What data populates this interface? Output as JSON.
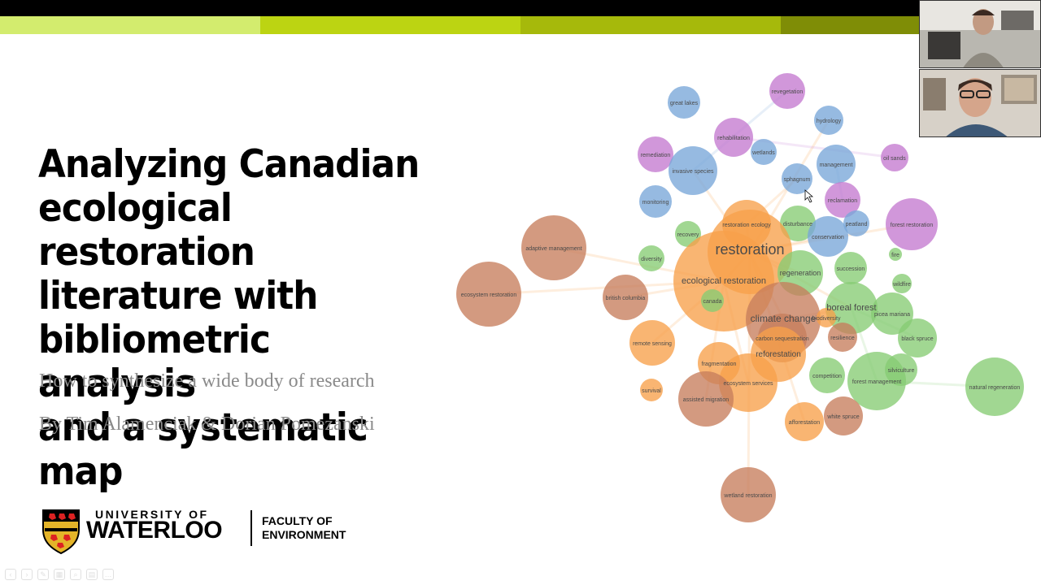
{
  "slide": {
    "title": "Analyzing Canadian\necological restoration\nliterature with\nbibliometric analysis\nand a systematic map",
    "subtitle": "How to synthesize a wide body of research",
    "authors": "By Tim Alamenciak & Dorian Pomezanski",
    "logo": {
      "university_line": "UNIVERSITY OF",
      "name": "WATERLOO",
      "faculty_line1": "FACULTY OF",
      "faculty_line2": "ENVIRONMENT"
    },
    "top_band_colors": [
      "#d3ec6e",
      "#bcd412",
      "#a6b90b",
      "#7f8d06"
    ]
  },
  "network": {
    "cluster_colors": {
      "blue": "#79a6d8",
      "purple": "#c47ad0",
      "orange": "#f7a04a",
      "green": "#86cc73",
      "brown": "#c67d5c"
    },
    "nodes": [
      {
        "label": "great lakes",
        "c": "blue"
      },
      {
        "label": "revegetation",
        "c": "purple"
      },
      {
        "label": "hydrology",
        "c": "blue"
      },
      {
        "label": "rehabilitation",
        "c": "purple"
      },
      {
        "label": "wetlands",
        "c": "blue"
      },
      {
        "label": "remediation",
        "c": "purple"
      },
      {
        "label": "invasive species",
        "c": "blue"
      },
      {
        "label": "management",
        "c": "blue"
      },
      {
        "label": "oil sands",
        "c": "purple"
      },
      {
        "label": "sphagnum",
        "c": "blue"
      },
      {
        "label": "monitoring",
        "c": "blue"
      },
      {
        "label": "reclamation",
        "c": "purple"
      },
      {
        "label": "restoration ecology",
        "c": "orange"
      },
      {
        "label": "disturbance",
        "c": "green"
      },
      {
        "label": "forest restoration",
        "c": "purple"
      },
      {
        "label": "peatland",
        "c": "blue"
      },
      {
        "label": "recovery",
        "c": "green"
      },
      {
        "label": "conservation",
        "c": "blue"
      },
      {
        "label": "adaptive management",
        "c": "brown"
      },
      {
        "label": "diversity",
        "c": "green"
      },
      {
        "label": "restoration",
        "c": "orange"
      },
      {
        "label": "fire",
        "c": "green"
      },
      {
        "label": "succession",
        "c": "green"
      },
      {
        "label": "regeneration",
        "c": "green"
      },
      {
        "label": "ecological restoration",
        "c": "orange"
      },
      {
        "label": "wildfire",
        "c": "green"
      },
      {
        "label": "ecosystem restoration",
        "c": "brown"
      },
      {
        "label": "british columbia",
        "c": "brown"
      },
      {
        "label": "canada",
        "c": "green"
      },
      {
        "label": "boreal forest",
        "c": "green"
      },
      {
        "label": "picea mariana",
        "c": "green"
      },
      {
        "label": "climate change",
        "c": "brown"
      },
      {
        "label": "biodiversity",
        "c": "orange"
      },
      {
        "label": "carbon sequestration",
        "c": "brown"
      },
      {
        "label": "resilience",
        "c": "brown"
      },
      {
        "label": "black spruce",
        "c": "green"
      },
      {
        "label": "remote sensing",
        "c": "orange"
      },
      {
        "label": "reforestation",
        "c": "orange"
      },
      {
        "label": "fragmentation",
        "c": "orange"
      },
      {
        "label": "silviculture",
        "c": "green"
      },
      {
        "label": "competition",
        "c": "green"
      },
      {
        "label": "natural regeneration",
        "c": "green"
      },
      {
        "label": "forest management",
        "c": "green"
      },
      {
        "label": "ecosystem services",
        "c": "orange"
      },
      {
        "label": "survival",
        "c": "orange"
      },
      {
        "label": "assisted migration",
        "c": "brown"
      },
      {
        "label": "white spruce",
        "c": "brown"
      },
      {
        "label": "afforestation",
        "c": "orange"
      },
      {
        "label": "wetland restoration",
        "c": "brown"
      }
    ]
  },
  "toolbar": {
    "buttons": [
      "prev-icon",
      "next-icon",
      "pen-icon",
      "slides-icon",
      "zoom-icon",
      "subtitles-icon",
      "more-icon"
    ]
  }
}
